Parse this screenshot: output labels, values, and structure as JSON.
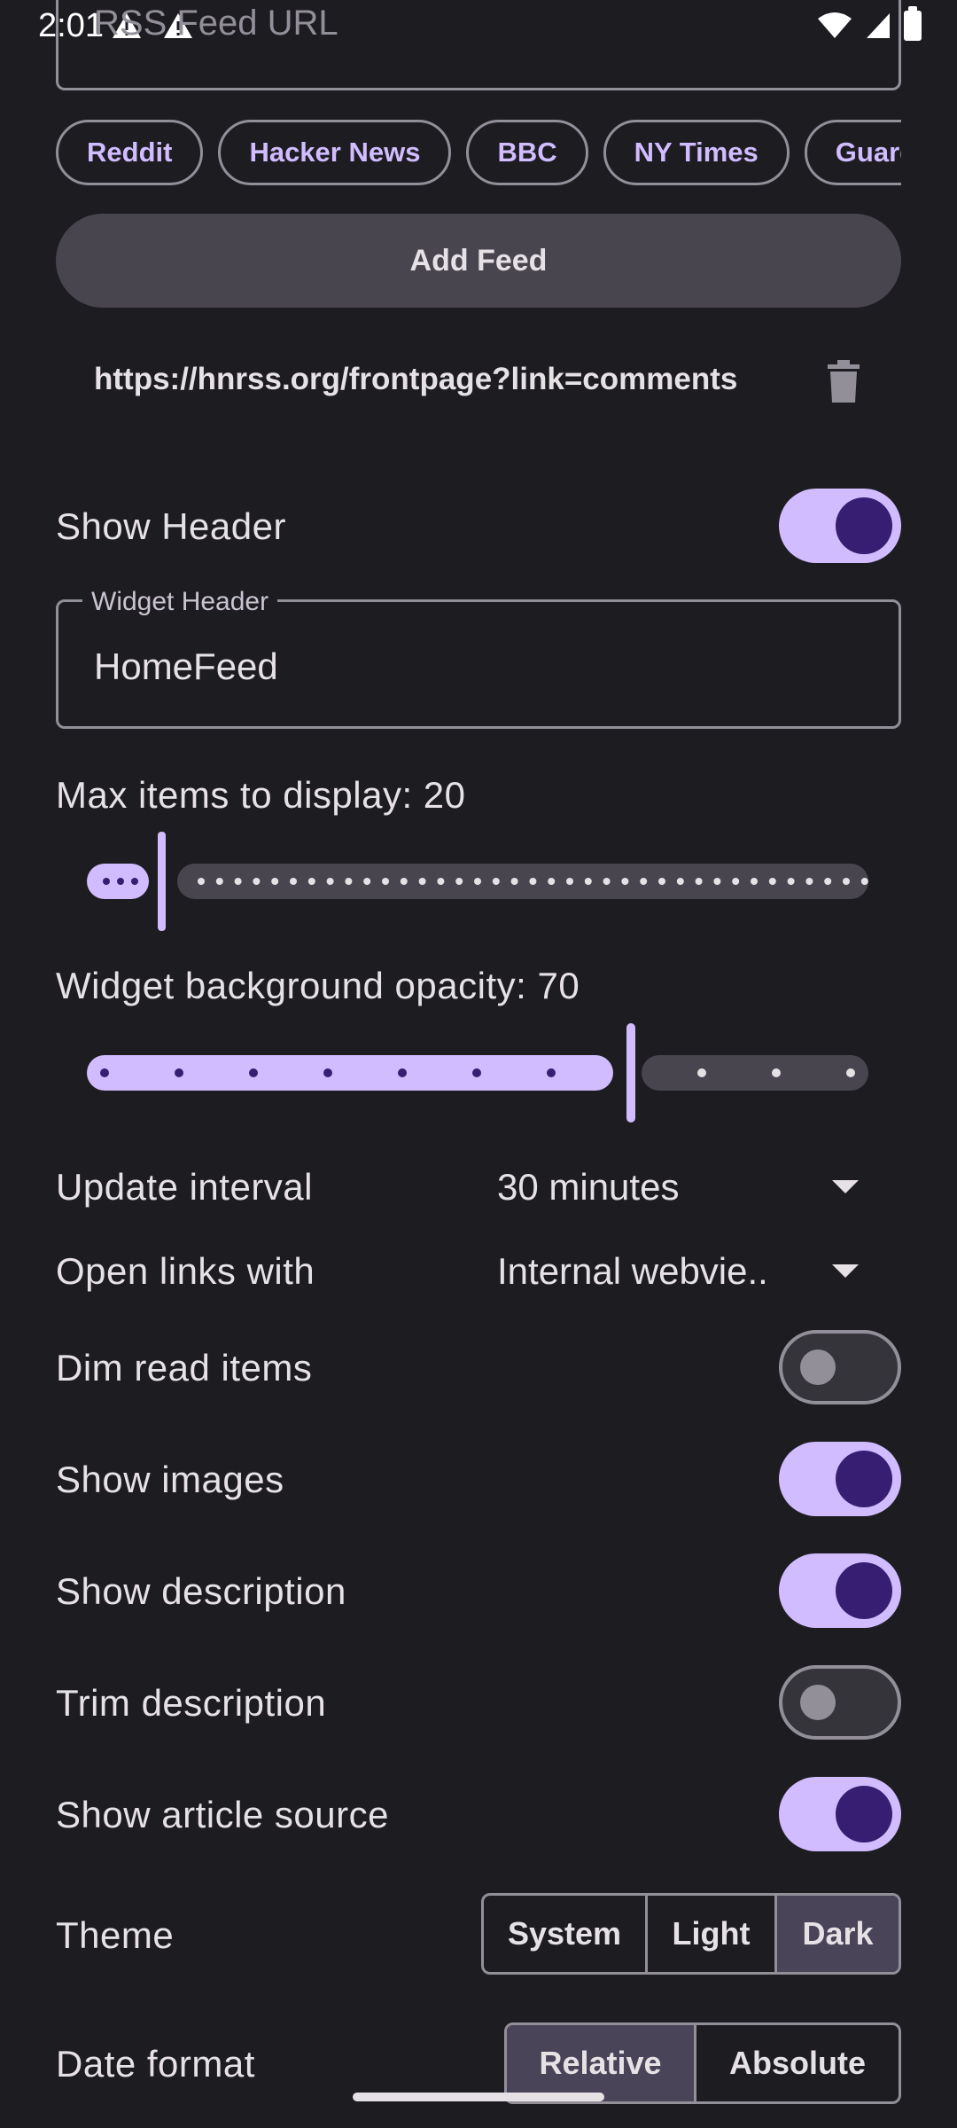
{
  "status_bar": {
    "time": "2:01"
  },
  "feed_input": {
    "placeholder": "RSS Feed URL"
  },
  "preset_chips": [
    "Reddit",
    "Hacker News",
    "BBC",
    "NY Times",
    "Guardia"
  ],
  "add_feed_label": "Add Feed",
  "feeds": [
    "https://hnrss.org/frontpage?link=comments"
  ],
  "show_header": {
    "label": "Show Header",
    "on": true
  },
  "widget_header": {
    "label": "Widget Header",
    "value": "HomeFeed"
  },
  "max_items": {
    "label": "Max items to display: 20",
    "value": 20
  },
  "opacity": {
    "label": "Widget background opacity: 70",
    "value": 70
  },
  "update_interval": {
    "label": "Update interval",
    "value": "30 minutes"
  },
  "open_links": {
    "label": "Open links with",
    "value": "Internal webvie.."
  },
  "toggles": [
    {
      "label": "Dim read items",
      "on": false
    },
    {
      "label": "Show images",
      "on": true
    },
    {
      "label": "Show description",
      "on": true
    },
    {
      "label": "Trim description",
      "on": false
    },
    {
      "label": "Show article source",
      "on": true
    }
  ],
  "theme": {
    "label": "Theme",
    "options": [
      "System",
      "Light",
      "Dark"
    ],
    "selected": "Dark"
  },
  "date_format": {
    "label": "Date format",
    "options": [
      "Relative",
      "Absolute"
    ],
    "selected": "Relative"
  },
  "colors": {
    "accent": "#d0bcff",
    "accent_dark": "#381e72",
    "background": "#1d1c21",
    "outline": "#938f99"
  }
}
